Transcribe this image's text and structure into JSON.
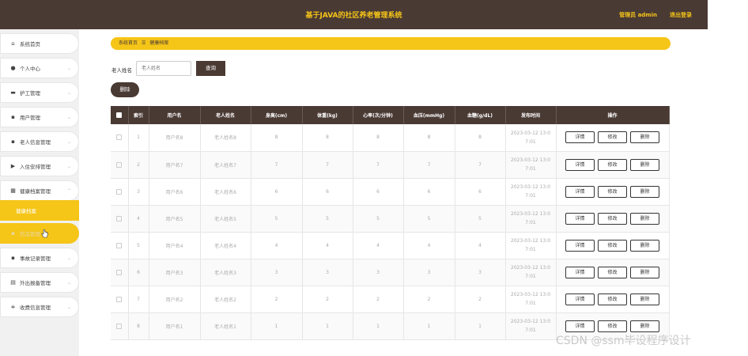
{
  "header": {
    "title": "基于JAVA的社区养老管理系统",
    "admin": "管理员 admin",
    "logout": "退出登录"
  },
  "sidebar": {
    "items": [
      {
        "icon": "⌂",
        "label": "系统首页",
        "chevron": ""
      },
      {
        "icon": "●",
        "label": "个人中心",
        "chevron": "⌄"
      },
      {
        "icon": "▬",
        "label": "护工管理",
        "chevron": "⌄"
      },
      {
        "icon": "▪",
        "label": "用户管理",
        "chevron": "⌄"
      },
      {
        "icon": "▪",
        "label": "老人信息管理",
        "chevron": "⌄"
      },
      {
        "icon": "▶",
        "label": "入住安排管理",
        "chevron": "⌄"
      },
      {
        "icon": "▦",
        "label": "健康档案管理",
        "chevron": "⌃"
      },
      {
        "icon": "",
        "label": "健康档案",
        "chevron": ""
      },
      {
        "icon": "▪",
        "label": "药品管理",
        "chevron": ""
      },
      {
        "icon": "▪",
        "label": "事故记录管理",
        "chevron": "⌄"
      },
      {
        "icon": "▤",
        "label": "外出报备管理",
        "chevron": "⌄"
      },
      {
        "icon": "≑",
        "label": "收费信息管理",
        "chevron": "⌄"
      }
    ]
  },
  "breadcrumb": {
    "home": "系统首页",
    "sep": "☰",
    "current": "健康档案"
  },
  "search": {
    "label": "老人姓名",
    "placeholder": "老人姓名",
    "button": "查询"
  },
  "actions": {
    "delete": "删除"
  },
  "table": {
    "columns": [
      "索引",
      "用户名",
      "老人姓名",
      "身高(cm)",
      "体重(kg)",
      "心率(次/分钟)",
      "血压(mmHg)",
      "血糖(g/dL)",
      "发布时间",
      "操作"
    ],
    "rows": [
      {
        "index": "1",
        "user": "用户名8",
        "elder": "老人姓名8",
        "height": "8",
        "weight": "8",
        "heart": "8",
        "bp": "8",
        "sugar": "8",
        "time1": "2023-03-12 13:0",
        "time2": "7:01"
      },
      {
        "index": "2",
        "user": "用户名7",
        "elder": "老人姓名7",
        "height": "7",
        "weight": "7",
        "heart": "7",
        "bp": "7",
        "sugar": "7",
        "time1": "2023-03-12 13:0",
        "time2": "7:01"
      },
      {
        "index": "3",
        "user": "用户名6",
        "elder": "老人姓名6",
        "height": "6",
        "weight": "6",
        "heart": "6",
        "bp": "6",
        "sugar": "6",
        "time1": "2023-03-12 13:0",
        "time2": "7:01"
      },
      {
        "index": "4",
        "user": "用户名5",
        "elder": "老人姓名5",
        "height": "5",
        "weight": "5",
        "heart": "5",
        "bp": "5",
        "sugar": "5",
        "time1": "2023-03-12 13:0",
        "time2": "7:01"
      },
      {
        "index": "5",
        "user": "用户名4",
        "elder": "老人姓名4",
        "height": "4",
        "weight": "4",
        "heart": "4",
        "bp": "4",
        "sugar": "4",
        "time1": "2023-03-12 13:0",
        "time2": "7:01"
      },
      {
        "index": "6",
        "user": "用户名3",
        "elder": "老人姓名3",
        "height": "3",
        "weight": "3",
        "heart": "3",
        "bp": "3",
        "sugar": "3",
        "time1": "2023-03-12 13:0",
        "time2": "7:01"
      },
      {
        "index": "7",
        "user": "用户名2",
        "elder": "老人姓名2",
        "height": "2",
        "weight": "2",
        "heart": "2",
        "bp": "2",
        "sugar": "2",
        "time1": "2023-03-12 13:0",
        "time2": "7:01"
      },
      {
        "index": "8",
        "user": "用户名1",
        "elder": "老人姓名1",
        "height": "1",
        "weight": "1",
        "heart": "1",
        "bp": "1",
        "sugar": "1",
        "time1": "2023-03-12 13:0",
        "time2": "7:01"
      }
    ],
    "ops": {
      "detail": "详情",
      "edit": "修改",
      "delete": "删除"
    }
  },
  "watermark": "CSDN @ssm毕设程序设计",
  "colors": {
    "header": "#4a3a34",
    "accent": "#f5c518"
  }
}
